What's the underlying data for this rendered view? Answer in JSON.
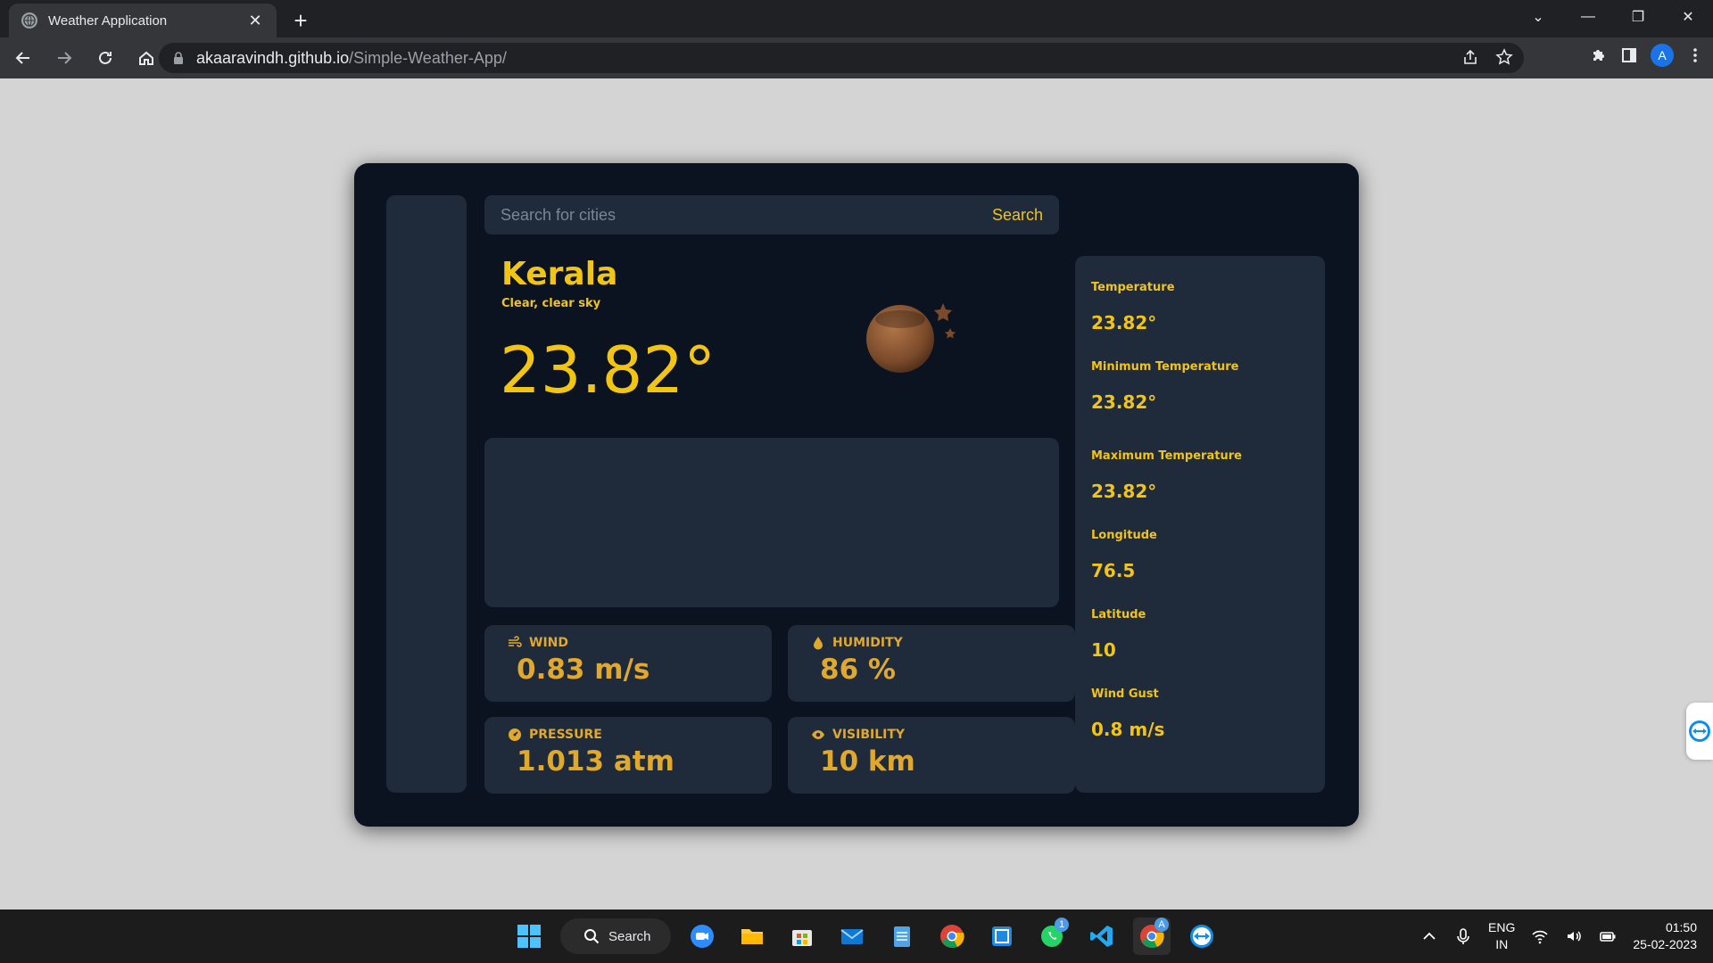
{
  "browser": {
    "tab_title": "Weather Application",
    "url_host": "akaaravindh.github.io",
    "url_path": "/Simple-Weather-App/",
    "profile_initial": "A"
  },
  "search": {
    "placeholder": "Search for cities",
    "button_label": "Search"
  },
  "current": {
    "city": "Kerala",
    "description": "Clear, clear sky",
    "temperature": "23.82°",
    "icon": "night-clear-icon"
  },
  "cards": {
    "wind": {
      "label": "WIND",
      "value": "0.83 m/s",
      "icon": "wind-icon"
    },
    "humidity": {
      "label": "HUMIDITY",
      "value": "86 %",
      "icon": "droplet-icon"
    },
    "pressure": {
      "label": "PRESSURE",
      "value": "1.013 atm",
      "icon": "gauge-icon"
    },
    "visibility": {
      "label": "VISIBILITY",
      "value": "10 km",
      "icon": "eye-icon"
    }
  },
  "details": [
    {
      "label": "Temperature",
      "value": "23.82°"
    },
    {
      "label": "Minimum Temperature",
      "value": "23.82°"
    },
    {
      "label": "Maximum Temperature",
      "value": "23.82°"
    },
    {
      "label": "Longitude",
      "value": "76.5"
    },
    {
      "label": "Latitude",
      "value": "10"
    },
    {
      "label": "Wind Gust",
      "value": "0.8 m/s"
    }
  ],
  "taskbar": {
    "search_label": "Search",
    "whatsapp_badge": "1",
    "chrome_badge": "A",
    "lang_top": "ENG",
    "lang_bottom": "IN",
    "time": "01:50",
    "date": "25-02-2023"
  },
  "colors": {
    "accent": "#f2c511",
    "card_accent": "#e0a92b",
    "panel": "#1f2a3a",
    "app_bg": "#0b1320"
  }
}
